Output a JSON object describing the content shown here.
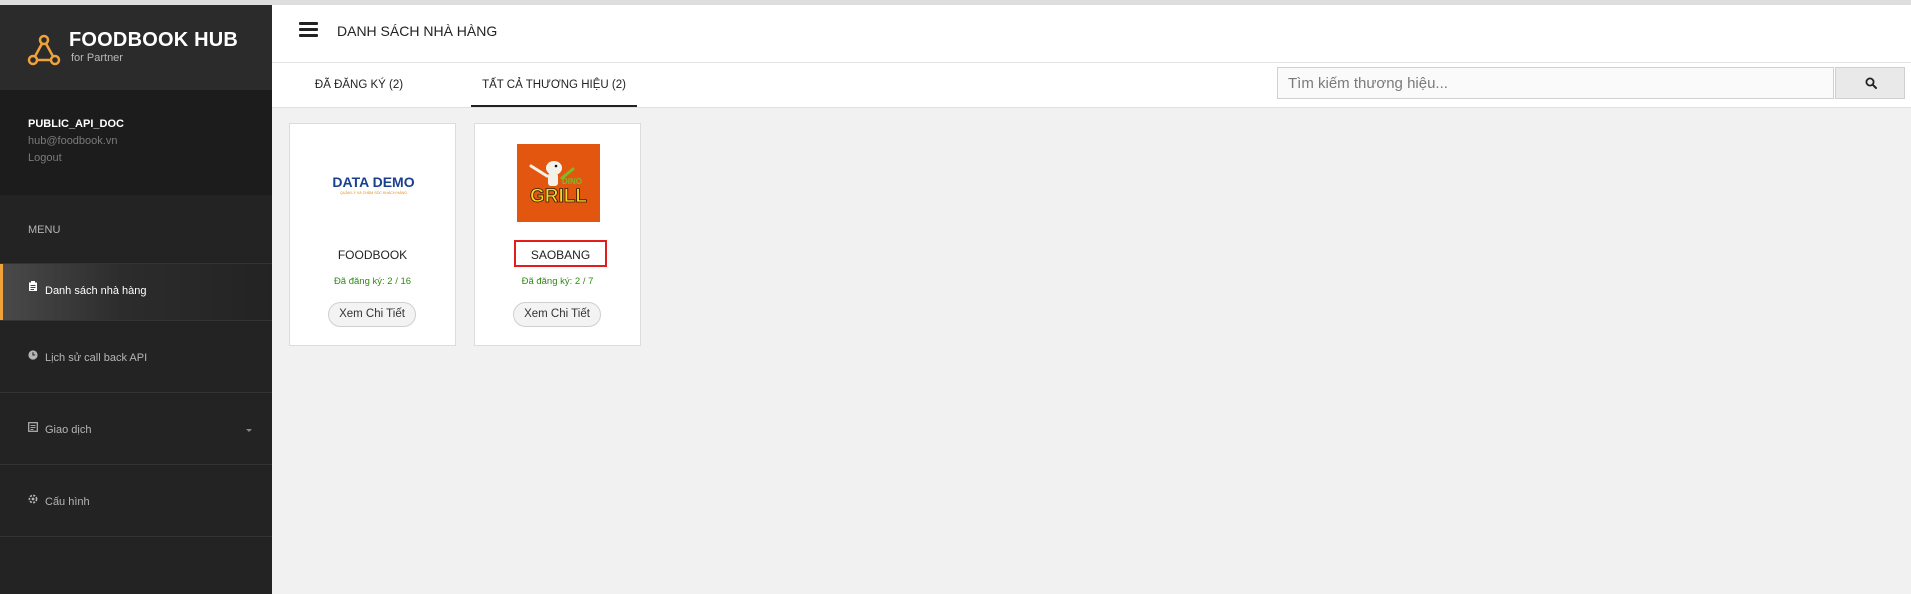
{
  "brand": {
    "name": "FOODBOOK HUB",
    "subtitle": "for Partner"
  },
  "user": {
    "name": "PUBLIC_API_DOC",
    "email": "hub@foodbook.vn",
    "logout": "Logout"
  },
  "menu": {
    "header": "MENU",
    "items": [
      {
        "label": "Danh sách nhà hàng",
        "icon": "clipboard-icon",
        "active": true
      },
      {
        "label": "Lịch sử call back API",
        "icon": "clock-icon",
        "active": false
      },
      {
        "label": "Giao dịch",
        "icon": "receipt-icon",
        "active": false,
        "has_dropdown": true
      },
      {
        "label": "Cấu hình",
        "icon": "settings-icon",
        "active": false
      }
    ]
  },
  "header": {
    "title": "DANH SÁCH NHÀ HÀNG"
  },
  "tabs": [
    {
      "label": "ĐÃ ĐĂNG KÝ (2)",
      "active": false
    },
    {
      "label": "TẤT CẢ THƯƠNG HIỆU (2)",
      "active": true
    }
  ],
  "search": {
    "placeholder": "Tìm kiếm thương hiệu...",
    "value": ""
  },
  "brands": [
    {
      "name": "FOODBOOK",
      "registered": "Đã đăng ký: 2 / 16",
      "button": "Xem Chi Tiết",
      "logo_text": "DATA DEMO",
      "logo_tagline": "QUẢN LÝ VÀ CHĂM SÓC KHÁCH HÀNG"
    },
    {
      "name": "SAOBANG",
      "registered": "Đã đăng ký: 2 / 7",
      "button": "Xem Chi Tiết",
      "logo_text": "GRILL",
      "logo_small": "DINO"
    }
  ],
  "colors": {
    "sidebar_bg": "#232323",
    "accent": "#f0a23b",
    "registered_text": "#2e8b12",
    "highlight_border": "#e41c1c",
    "grill_logo_bg": "#e2560f"
  }
}
